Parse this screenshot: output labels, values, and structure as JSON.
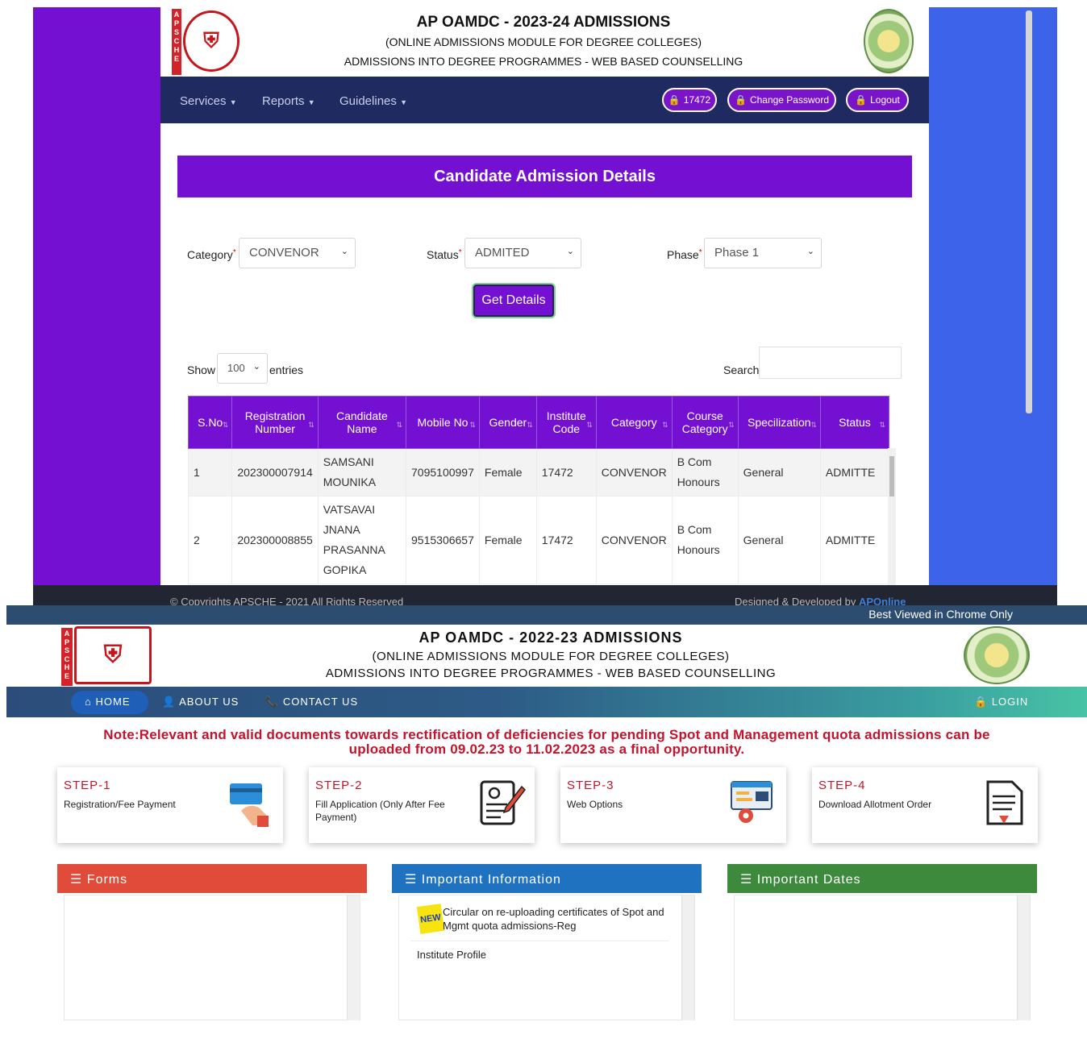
{
  "top": {
    "header": {
      "title": "AP OAMDC - 2023-24 ADMISSIONS",
      "subtitle": "(ONLINE ADMISSIONS MODULE FOR DEGREE COLLEGES)",
      "subtitle2": "ADMISSIONS INTO DEGREE PROGRAMMES - WEB BASED COUNSELLING",
      "apsche": "APSCHE"
    },
    "nav": {
      "services": "Services",
      "reports": "Reports",
      "guidelines": "Guidelines",
      "user_code": "17472",
      "change_password": "Change Password",
      "logout": "Logout"
    },
    "form": {
      "heading": "Candidate Admission Details",
      "category_label": "Category",
      "category_value": "CONVENOR",
      "status_label": "Status",
      "status_value": "ADMITED",
      "phase_label": "Phase",
      "phase_value": "Phase 1",
      "get_details": "Get Details",
      "show_label": "Show",
      "entries_value": "100",
      "entries_label": "entries",
      "search_label": "Search:"
    },
    "table": {
      "headers": [
        "S.No",
        "Registration Number",
        "Candidate Name",
        "Mobile No",
        "Gender",
        "Institute Code",
        "Category",
        "Course Category",
        "Specilization",
        "Status"
      ],
      "rows": [
        [
          "1",
          "202300007914",
          "SAMSANI MOUNIKA",
          "7095100997",
          "Female",
          "17472",
          "CONVENOR",
          "B Com Honours",
          "General",
          "ADMITTE"
        ],
        [
          "2",
          "202300008855",
          "VATSAVAI JNANA PRASANNA GOPIKA",
          "9515306657",
          "Female",
          "17472",
          "CONVENOR",
          "B Com Honours",
          "General",
          "ADMITTE"
        ]
      ]
    },
    "footer": {
      "copyright": "© Copyrights APSCHE - 2021 All Rights Reserved",
      "designed": "Designed & Developed by",
      "brand": "APOnline"
    }
  },
  "bottom": {
    "best_viewed": "Best Viewed in Chrome Only",
    "header": {
      "title": "AP OAMDC - 2022-23 ADMISSIONS",
      "subtitle": "(ONLINE ADMISSIONS MODULE FOR DEGREE COLLEGES)",
      "subtitle2": "ADMISSIONS INTO DEGREE PROGRAMMES - WEB BASED COUNSELLING"
    },
    "nav": {
      "home": "HOME",
      "about": "ABOUT US",
      "contact": "CONTACT US",
      "login": "LOGIN"
    },
    "note_line1": "Note:Relevant and valid documents towards rectification of deficiencies for pending Spot and Management quota admissions can be",
    "note_line2": "uploaded from 09.02.23 to 11.02.2023 as a final opportunity.",
    "steps": [
      {
        "title": "STEP-1",
        "text": "Registration/Fee Payment",
        "icon": "card-payment-icon"
      },
      {
        "title": "STEP-2",
        "text": "Fill Application (Only After Fee Payment)",
        "icon": "application-form-icon"
      },
      {
        "title": "STEP-3",
        "text": "Web Options",
        "icon": "web-options-icon"
      },
      {
        "title": "STEP-4",
        "text": "Download Allotment Order",
        "icon": "download-document-icon"
      }
    ],
    "panels": {
      "forms": "Forms",
      "info": "Important Information",
      "dates": "Important Dates",
      "info_new_badge": "NEW",
      "info_item1": "Circular on re-uploading certificates of Spot and Mgmt quota admissions-Reg",
      "info_item2": "Institute Profile"
    },
    "colors": {
      "forms": "#e04b3a",
      "info": "#1f72bf",
      "dates": "#3d8a3d"
    }
  }
}
